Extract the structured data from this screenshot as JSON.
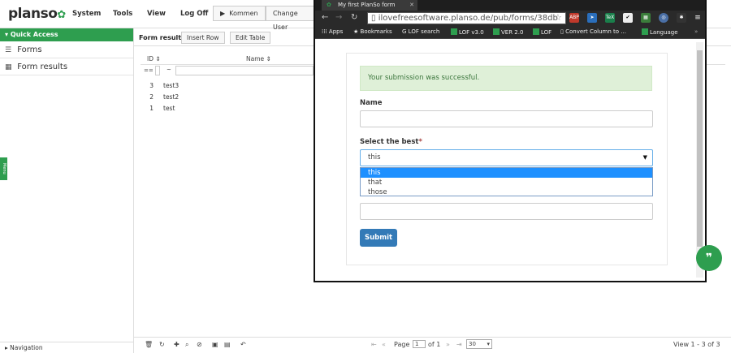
{
  "app": {
    "logo": "planso",
    "nav": [
      "System",
      "Tools",
      "View",
      "Log Off"
    ],
    "buttons": [
      "Kommen",
      "Change User"
    ]
  },
  "sidebar": {
    "quick_access": "Quick Access",
    "items": [
      {
        "label": "Forms",
        "icon": "list-icon"
      },
      {
        "label": "Form results",
        "icon": "table-icon"
      }
    ],
    "menu_tab": "Menu",
    "navigation": "Navigation"
  },
  "results": {
    "title": "Form results",
    "insert_row": "Insert Row",
    "edit_table": "Edit Table",
    "columns": [
      "ID",
      "Name"
    ],
    "filter_op": "==",
    "filter_op2": "~",
    "rows": [
      {
        "id": "3",
        "name": "test3"
      },
      {
        "id": "2",
        "name": "test2"
      },
      {
        "id": "1",
        "name": "test"
      }
    ],
    "pager": {
      "page_label": "Page",
      "page_value": "1",
      "of_label": "of 1",
      "rows_per_page": "30",
      "view_info": "View 1 - 3 of 3"
    }
  },
  "browser": {
    "tab_title": "My first PlanSo form",
    "url": "ilovefreesoftware.planso.de/pub/forms/38db",
    "bookmarks": [
      "Apps",
      "Bookmarks",
      "LOF search",
      "LOF v3.0",
      "VER 2.0",
      "LOF",
      "Convert Column to ...",
      "Language"
    ]
  },
  "form": {
    "success": "Your submission was successful.",
    "name_label": "Name",
    "select_label": "Select the best",
    "select_value": "this",
    "options": [
      "this",
      "that",
      "those"
    ],
    "submit": "Submit"
  },
  "colors": {
    "brand_green": "#2e9e4f",
    "submit_blue": "#337ab7",
    "success_bg": "#dff0d8"
  }
}
